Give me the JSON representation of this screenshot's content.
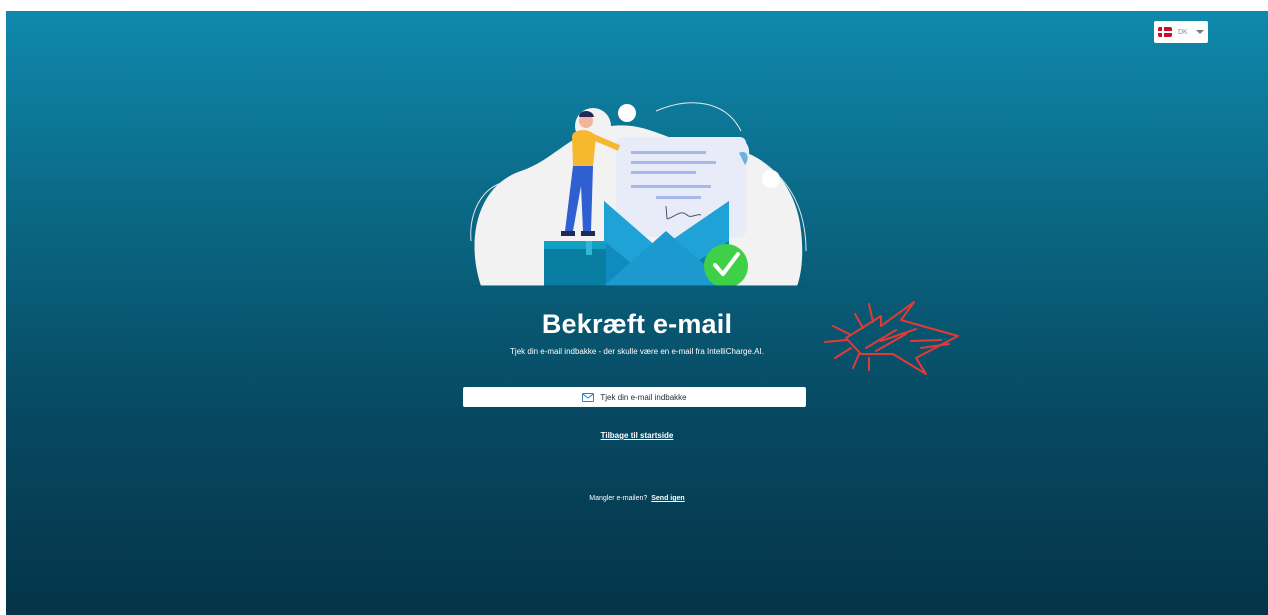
{
  "language": {
    "selected": "DK",
    "flag_colors": {
      "red": "#c8102e",
      "white": "#ffffff"
    }
  },
  "main": {
    "title": "Bekræft e-mail",
    "subtitle": "Tjek din e-mail indbakke - der skulle være en e-mail fra IntelliCharge.AI.",
    "inbox_button_label": "Tjek din e-mail indbakke",
    "back_link": "Tilbage til startside",
    "resend_prompt": "Mangler e-mailen?",
    "resend_link": "Send igen"
  },
  "icons": {
    "inbox_button": "envelope-icon",
    "language_caret": "chevron-down-icon"
  },
  "colors": {
    "background_top": "#0f89ad",
    "background_bottom": "#043448",
    "annotation": "#e53935",
    "envelope": "#1fa2d6",
    "check": "#3ed047"
  }
}
